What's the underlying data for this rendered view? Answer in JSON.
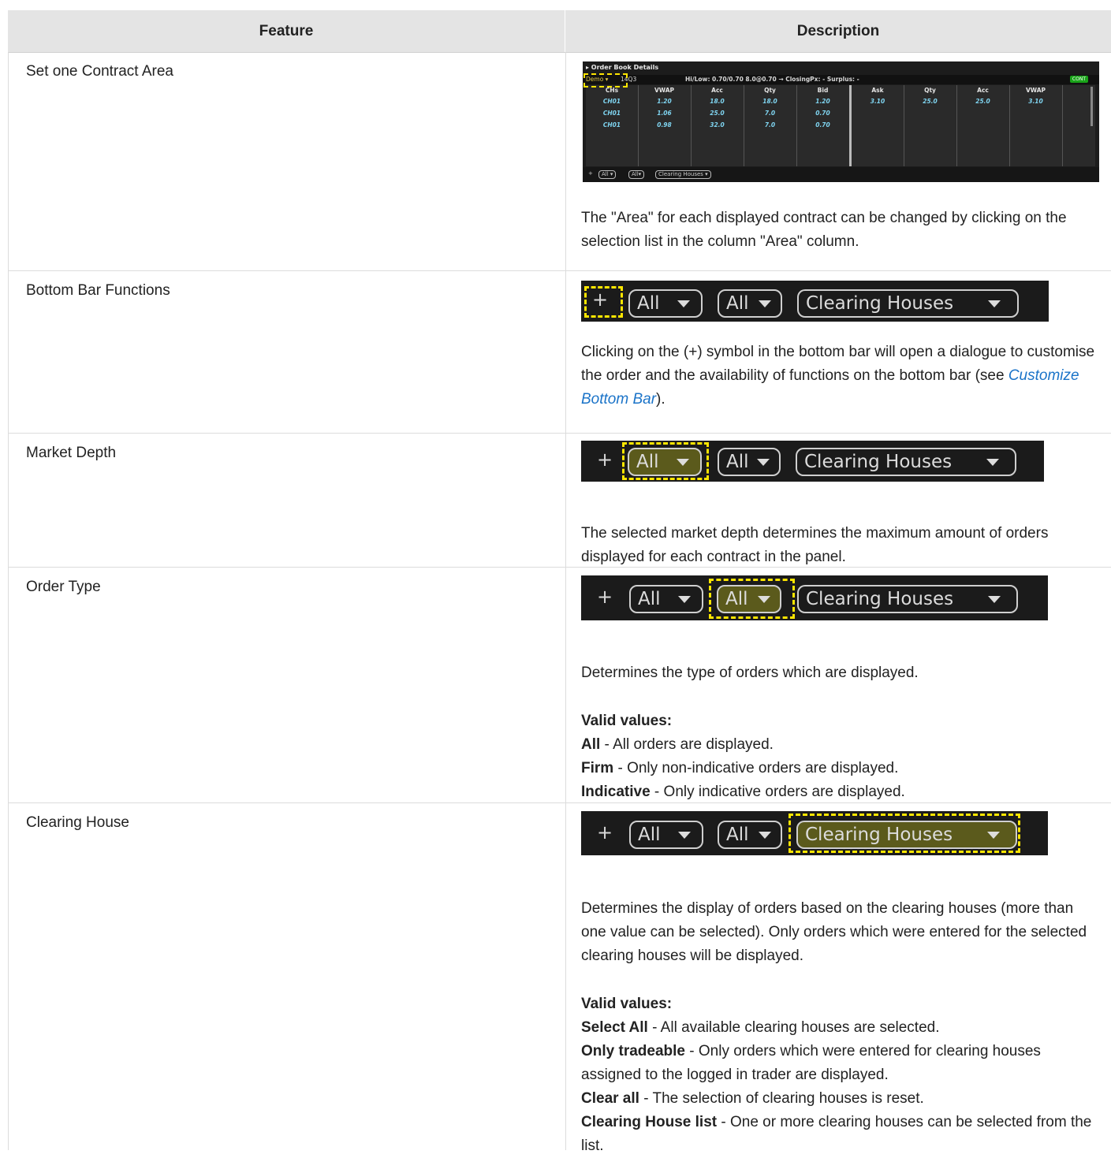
{
  "header": {
    "feature": "Feature",
    "description": "Description"
  },
  "rows": [
    {
      "feature": "Set one Contract Area",
      "text": "The \"Area\" for each displayed contract can be changed by clicking on the selection list in the column \"Area\" column.",
      "orderbook": {
        "title": "▸ Order Book Details",
        "area_value": "Demo ▾",
        "contract": "14Q3",
        "info": "Hi/Low:  0.70/0.70   8.0@0.70 → ClosingPx:  - Surplus:  -",
        "status_badge": "CONT",
        "columns": [
          "CHs",
          "VWAP",
          "Acc",
          "Qty",
          "Bid",
          "Ask",
          "Qty",
          "Acc",
          "VWAP"
        ],
        "bid_rows": [
          [
            "CH01",
            "1.20",
            "18.0",
            "18.0",
            "1.20"
          ],
          [
            "CH01",
            "1.06",
            "25.0",
            "7.0",
            "0.70"
          ],
          [
            "CH01",
            "0.98",
            "32.0",
            "7.0",
            "0.70"
          ]
        ],
        "ask_rows": [
          [
            "3.10",
            "25.0",
            "25.0",
            "3.10"
          ]
        ],
        "bottom": {
          "plus": "+",
          "depth": "All ▾",
          "type": "All▾",
          "clearing": "Clearing Houses   ▾"
        }
      }
    },
    {
      "feature": "Bottom Bar Functions",
      "text_before": "Clicking on the (+) symbol in the bottom bar will open a dialogue to customise the order and the availability of functions on the bottom bar (see ",
      "link": "Customize Bottom Bar",
      "text_after": ")."
    },
    {
      "feature": "Market Depth",
      "text": "The selected market depth determines the maximum amount of orders displayed for each contract in the panel."
    },
    {
      "feature": "Order Type",
      "text": "Determines the type of orders which are displayed.",
      "valid_heading": "Valid values:",
      "values": [
        {
          "name": "All",
          "desc": " - All orders are displayed."
        },
        {
          "name": "Firm",
          "desc": " - Only non-indicative orders are displayed."
        },
        {
          "name": "Indicative",
          "desc": " - Only indicative orders are displayed."
        }
      ]
    },
    {
      "feature": "Clearing House",
      "text": "Determines the display of orders based on the clearing houses (more than one value can be selected). Only orders which were entered for the selected clearing houses will be displayed.",
      "valid_heading": "Valid values:",
      "values": [
        {
          "name": "Select All",
          "desc": " - All available clearing houses are selected."
        },
        {
          "name": "Only tradeable",
          "desc": " - Only orders which were entered for clearing houses assigned to the logged in trader are displayed."
        },
        {
          "name": "Clear all",
          "desc": " - The selection of clearing houses is reset."
        },
        {
          "name": "Clearing House list",
          "desc": " - One or more clearing houses can be selected from the list."
        }
      ]
    }
  ],
  "bar": {
    "plus": "+",
    "depth": "All",
    "type": "All",
    "clearing": "Clearing Houses"
  },
  "colors": {
    "highlight": "#ffe600",
    "link": "#1a73c8",
    "header_bg": "#e4e4e4"
  }
}
